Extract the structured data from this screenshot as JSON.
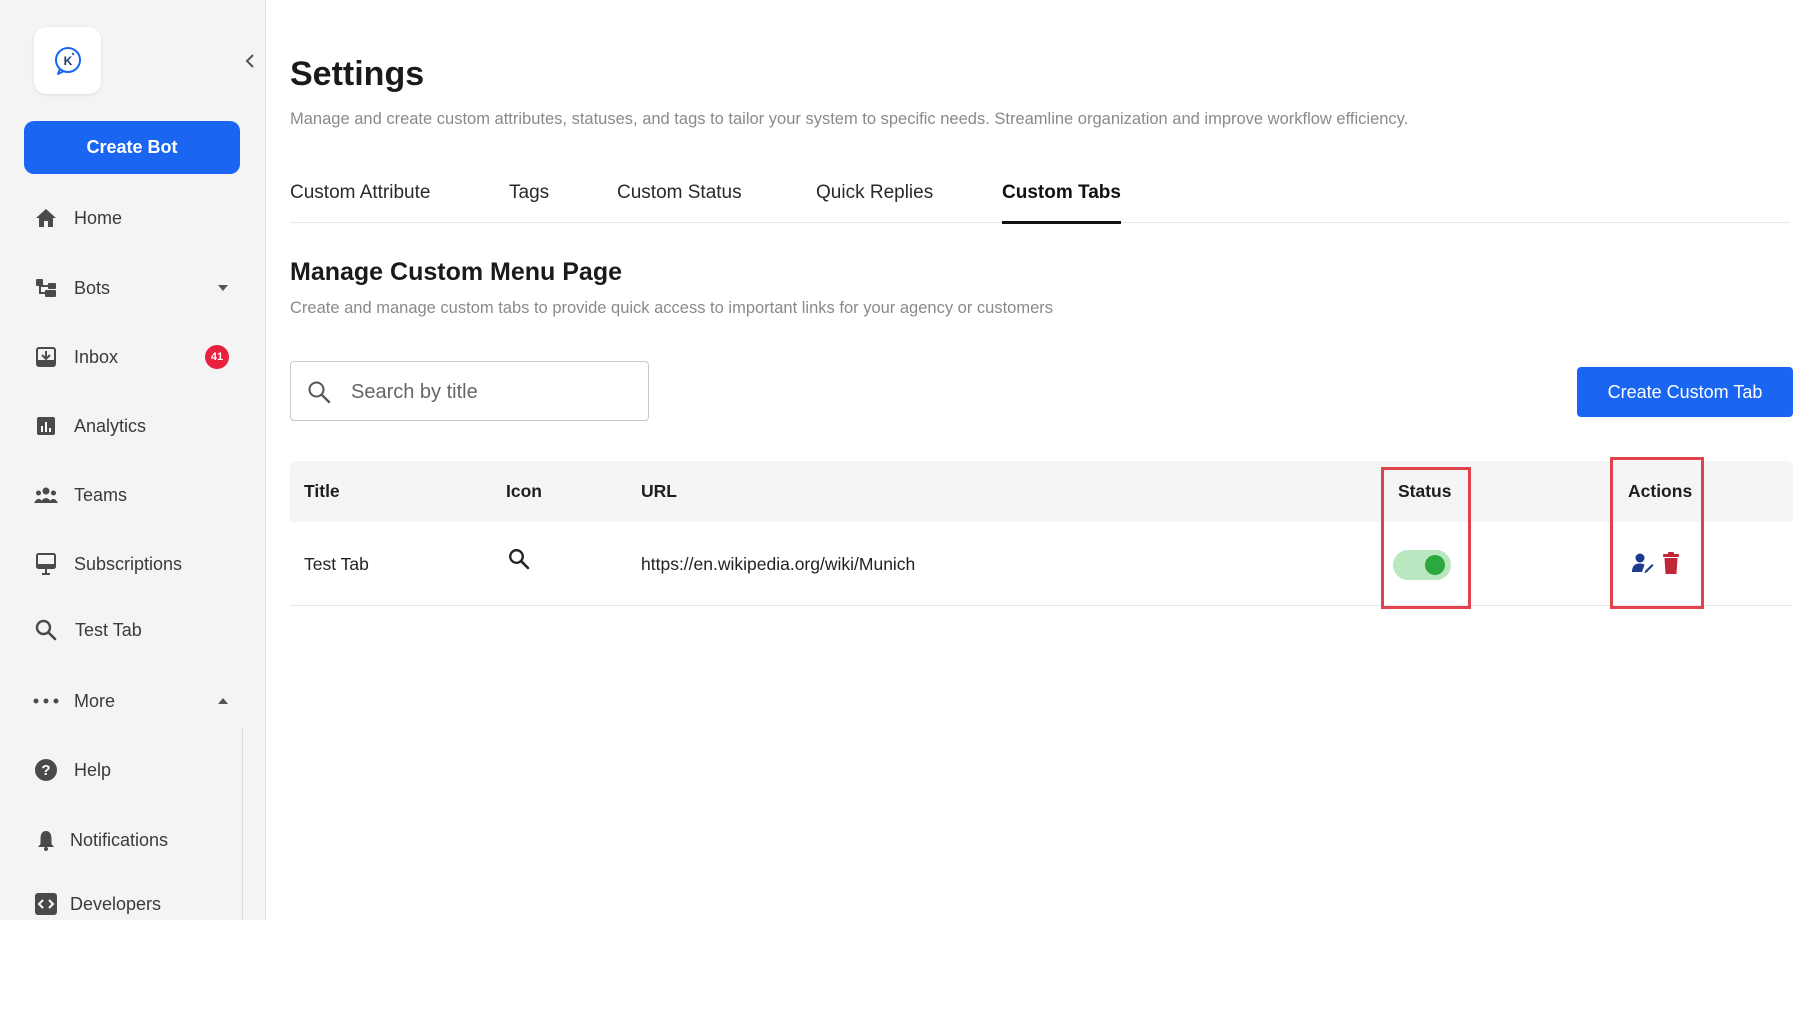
{
  "sidebar": {
    "create_bot_label": "Create Bot",
    "items": [
      {
        "label": "Home",
        "icon": "home-icon"
      },
      {
        "label": "Bots",
        "icon": "bots-icon"
      },
      {
        "label": "Inbox",
        "icon": "inbox-icon",
        "badge": "41"
      },
      {
        "label": "Analytics",
        "icon": "analytics-icon"
      },
      {
        "label": "Teams",
        "icon": "teams-icon"
      },
      {
        "label": "Subscriptions",
        "icon": "subscriptions-icon"
      },
      {
        "label": "Test Tab",
        "icon": "search-icon"
      },
      {
        "label": "More",
        "icon": "more-dots-icon"
      },
      {
        "label": "Help",
        "icon": "help-icon"
      },
      {
        "label": "Notifications",
        "icon": "bell-icon"
      },
      {
        "label": "Developers",
        "icon": "code-icon"
      }
    ]
  },
  "header": {
    "title": "Settings",
    "subtitle": "Manage and create custom attributes, statuses, and tags to tailor your system to specific needs. Streamline organization and improve workflow efficiency."
  },
  "tabs": [
    {
      "label": "Custom Attribute",
      "active": false
    },
    {
      "label": "Tags",
      "active": false
    },
    {
      "label": "Custom Status",
      "active": false
    },
    {
      "label": "Quick Replies",
      "active": false
    },
    {
      "label": "Custom Tabs",
      "active": true
    }
  ],
  "section": {
    "title": "Manage Custom Menu Page",
    "subtitle": "Create and manage custom tabs to provide quick access to important links for your agency or customers"
  },
  "search": {
    "placeholder": "Search by title",
    "value": ""
  },
  "create_button_label": "Create Custom Tab",
  "table": {
    "columns": [
      "Title",
      "Icon",
      "URL",
      "Status",
      "Actions"
    ],
    "rows": [
      {
        "title": "Test Tab",
        "icon": "search-icon",
        "url": "https://en.wikipedia.org/wiki/Munich",
        "status_enabled": true
      }
    ]
  },
  "colors": {
    "accent": "#1a66f2",
    "badge": "#e8213f",
    "toggle_on": "#2ba93f",
    "highlight": "#e0434c",
    "delete": "#c0283a",
    "edit": "#1e3a8a"
  }
}
